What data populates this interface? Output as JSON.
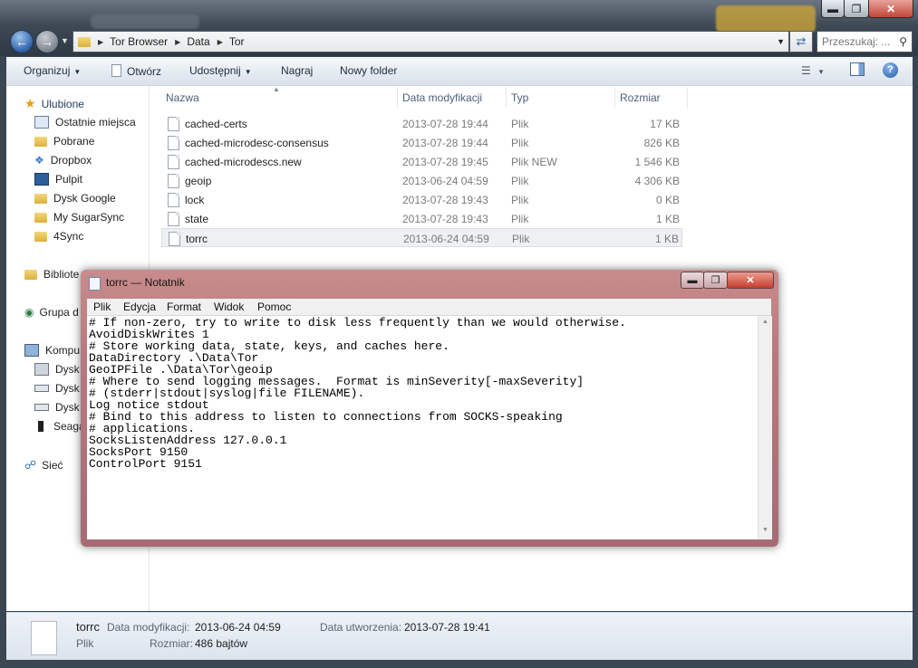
{
  "explorer": {
    "breadcrumb": [
      "Tor Browser",
      "Data",
      "Tor"
    ],
    "search_placeholder": "Przeszukaj: ...",
    "toolbar": {
      "organize": "Organizuj",
      "open": "Otwórz",
      "share": "Udostępnij",
      "burn": "Nagraj",
      "new_folder": "Nowy folder"
    },
    "nav": {
      "favorites": "Ulubione",
      "favorites_items": [
        "Ostatnie miejsca",
        "Pobrane",
        "Dropbox",
        "Pulpit",
        "Dysk Google",
        "My SugarSync",
        "4Sync"
      ],
      "libraries": "Bibliote",
      "homegroup": "Grupa d",
      "computer": "Kompu",
      "computer_items": [
        "Dysk",
        "Dysk",
        "Dysk",
        "Seaga"
      ],
      "network": "Sieć"
    },
    "columns": {
      "name": "Nazwa",
      "modified": "Data modyfikacji",
      "type": "Typ",
      "size": "Rozmiar"
    },
    "files": [
      {
        "name": "cached-certs",
        "modified": "2013-07-28 19:44",
        "type": "Plik",
        "size": "17 KB"
      },
      {
        "name": "cached-microdesc-consensus",
        "modified": "2013-07-28 19:44",
        "type": "Plik",
        "size": "826 KB"
      },
      {
        "name": "cached-microdescs.new",
        "modified": "2013-07-28 19:45",
        "type": "Plik NEW",
        "size": "1 546 KB"
      },
      {
        "name": "geoip",
        "modified": "2013-06-24 04:59",
        "type": "Plik",
        "size": "4 306 KB"
      },
      {
        "name": "lock",
        "modified": "2013-07-28 19:43",
        "type": "Plik",
        "size": "0 KB"
      },
      {
        "name": "state",
        "modified": "2013-07-28 19:43",
        "type": "Plik",
        "size": "1 KB"
      },
      {
        "name": "torrc",
        "modified": "2013-06-24 04:59",
        "type": "Plik",
        "size": "1 KB",
        "selected": true
      }
    ],
    "details": {
      "name": "torrc",
      "type": "Plik",
      "modified_label": "Data modyfikacji:",
      "modified_value": "2013-06-24 04:59",
      "created_label": "Data utworzenia:",
      "created_value": "2013-07-28 19:41",
      "size_label": "Rozmiar:",
      "size_value": "486 bajtów"
    }
  },
  "notepad": {
    "title": "torrc — Notatnik",
    "menu": [
      "Plik",
      "Edycja",
      "Format",
      "Widok",
      "Pomoc"
    ],
    "lines": [
      "# If non-zero, try to write to disk less frequently than we would otherwise.",
      "AvoidDiskWrites 1",
      "# Store working data, state, keys, and caches here.",
      "DataDirectory .\\Data\\Tor",
      "GeoIPFile .\\Data\\Tor\\geoip",
      "# Where to send logging messages.  Format is minSeverity[-maxSeverity]",
      "# (stderr|stdout|syslog|file FILENAME).",
      "Log notice stdout",
      "# Bind to this address to listen to connections from SOCKS-speaking",
      "# applications.",
      "SocksListenAddress 127.0.0.1",
      "SocksPort 9150",
      "ControlPort 9151"
    ]
  }
}
